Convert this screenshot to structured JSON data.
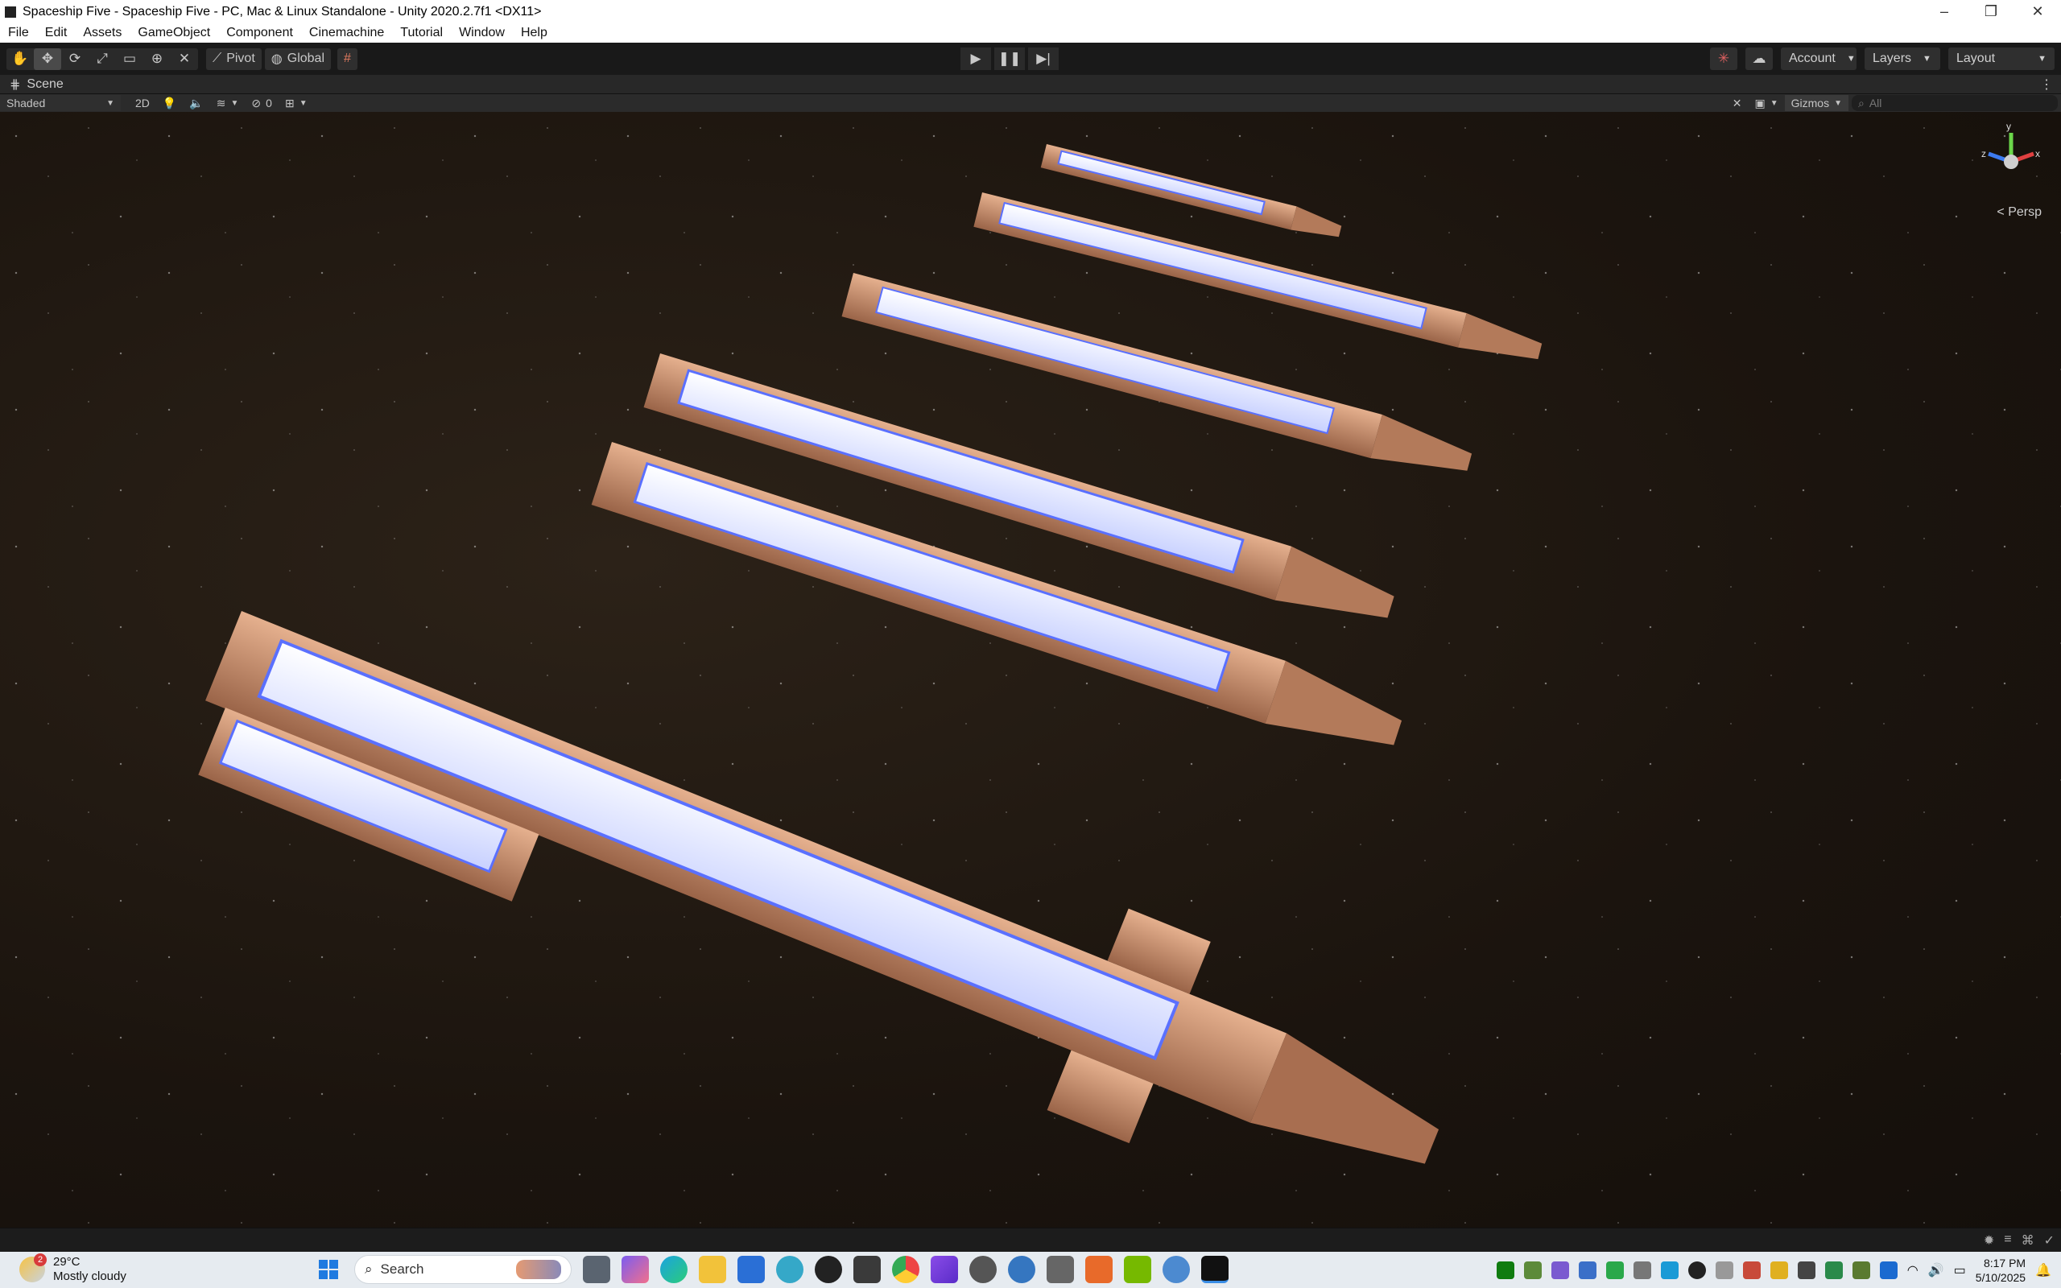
{
  "window": {
    "title": "Spaceship Five - Spaceship Five - PC, Mac & Linux Standalone - Unity 2020.2.7f1 <DX11>",
    "controls": {
      "minimize": "–",
      "maximize": "❐",
      "close": "✕"
    }
  },
  "menu": [
    "File",
    "Edit",
    "Assets",
    "GameObject",
    "Component",
    "Cinemachine",
    "Tutorial",
    "Window",
    "Help"
  ],
  "toolbar": {
    "pivot_label": "Pivot",
    "global_label": "Global",
    "account_label": "Account",
    "layers_label": "Layers",
    "layout_label": "Layout"
  },
  "scene": {
    "tab_label": "Scene",
    "shading_mode": "Shaded",
    "mode_2d": "2D",
    "hidden_count": "0",
    "gizmos_label": "Gizmos",
    "search_placeholder": "All",
    "perspective_label": "< Persp",
    "gizmo_axes": {
      "y": "y",
      "z": "z",
      "x": "x"
    }
  },
  "taskbar": {
    "weather_temp": "29°C",
    "weather_desc": "Mostly cloudy",
    "weather_badge": "2",
    "search_label": "Search",
    "time": "8:17 PM",
    "date": "5/10/2025"
  },
  "colors": {
    "hull": "#c89070",
    "panel_glow": "#5a70ff",
    "panel_light": "#eef2ff",
    "space": "#1b140e"
  }
}
